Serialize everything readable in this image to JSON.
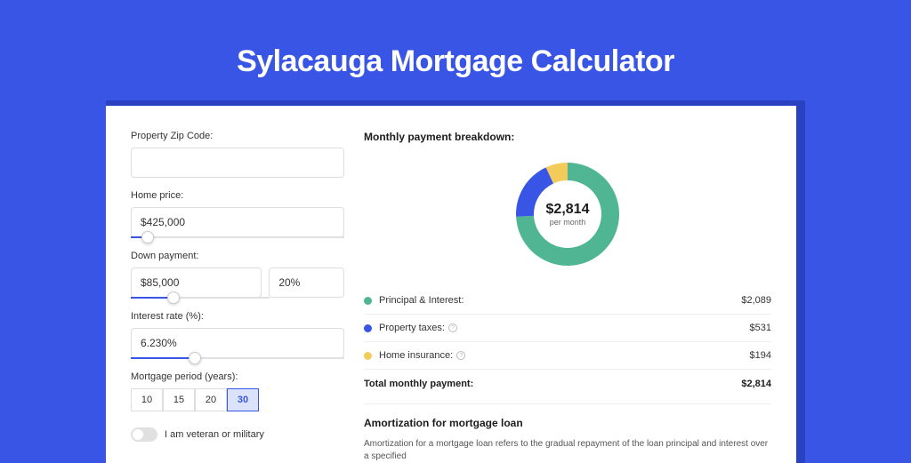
{
  "page_title": "Sylacauga Mortgage Calculator",
  "form": {
    "zip_label": "Property Zip Code:",
    "zip_value": "",
    "home_price_label": "Home price:",
    "home_price_value": "$425,000",
    "home_price_slider_pct": 8,
    "down_payment_label": "Down payment:",
    "down_payment_value": "$85,000",
    "down_payment_pct_value": "20%",
    "down_payment_slider_pct": 20,
    "interest_label": "Interest rate (%):",
    "interest_value": "6.230%",
    "interest_slider_pct": 30,
    "period_label": "Mortgage period (years):",
    "period_options": [
      "10",
      "15",
      "20",
      "30"
    ],
    "period_selected": "30",
    "veteran_label": "I am veteran or military",
    "veteran_on": false
  },
  "breakdown": {
    "title": "Monthly payment breakdown:",
    "center_amount": "$2,814",
    "center_sub": "per month",
    "items": [
      {
        "label": "Principal & Interest:",
        "value": "$2,089",
        "color": "#4fb592",
        "has_info": false
      },
      {
        "label": "Property taxes:",
        "value": "$531",
        "color": "#3955e5",
        "has_info": true
      },
      {
        "label": "Home insurance:",
        "value": "$194",
        "color": "#f2cb5a",
        "has_info": true
      }
    ],
    "total_label": "Total monthly payment:",
    "total_value": "$2,814"
  },
  "chart_data": {
    "type": "pie",
    "title": "Monthly payment breakdown",
    "series": [
      {
        "name": "Principal & Interest",
        "value": 2089,
        "color": "#4fb592"
      },
      {
        "name": "Property taxes",
        "value": 531,
        "color": "#3955e5"
      },
      {
        "name": "Home insurance",
        "value": 194,
        "color": "#f2cb5a"
      }
    ],
    "total": 2814,
    "donut": true
  },
  "amortization": {
    "title": "Amortization for mortgage loan",
    "text": "Amortization for a mortgage loan refers to the gradual repayment of the loan principal and interest over a specified"
  }
}
